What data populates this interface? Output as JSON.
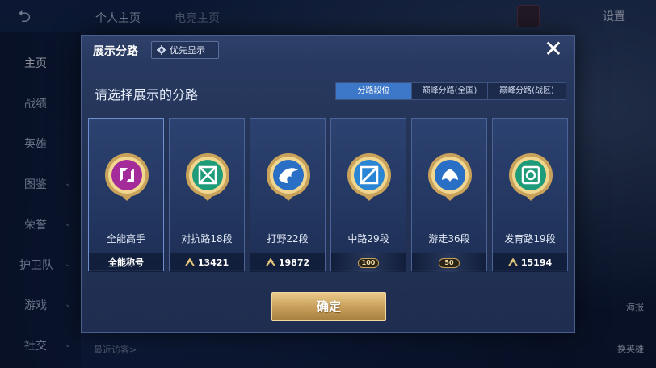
{
  "background": {
    "tabs": [
      "个人主页",
      "电竞主页"
    ],
    "settings_label": "设置",
    "sidebar": [
      {
        "label": "主页",
        "active": true
      },
      {
        "label": "战绩"
      },
      {
        "label": "英雄"
      },
      {
        "label": "图鉴"
      },
      {
        "label": "荣誉"
      },
      {
        "label": "护卫队"
      },
      {
        "label": "游戏"
      },
      {
        "label": "社交"
      }
    ],
    "recent_visitors_label": "最近访客>",
    "right_labels": [
      "海报",
      "换英雄"
    ]
  },
  "modal": {
    "title": "展示分路",
    "priority_button": "优先显示",
    "close_symbol": "✕",
    "subtitle": "请选择展示的分路",
    "segments": [
      {
        "label": "分路段位",
        "active": true
      },
      {
        "label": "巅峰分路(全国)",
        "active": false
      },
      {
        "label": "巅峰分路(战区)",
        "active": false
      }
    ],
    "cards": [
      {
        "label": "全能高手",
        "footer": "全能称号",
        "icon": "all-round-emblem",
        "color": "#b23aa8"
      },
      {
        "label": "对抗路18段",
        "footer": "13421",
        "icon": "clash-lane-emblem",
        "color": "#1e9c7a"
      },
      {
        "label": "打野22段",
        "footer": "19872",
        "icon": "jungle-dragon-emblem",
        "color": "#2a6fc6"
      },
      {
        "label": "中路29段",
        "footer": "100",
        "icon": "mid-lane-emblem",
        "color": "#2a86d4"
      },
      {
        "label": "游走36段",
        "footer": "50",
        "icon": "roam-wings-emblem",
        "color": "#2a6fc6"
      },
      {
        "label": "发育路19段",
        "footer": "15194",
        "icon": "farm-lane-emblem",
        "color": "#1e9c7a"
      }
    ],
    "confirm_label": "确定"
  }
}
